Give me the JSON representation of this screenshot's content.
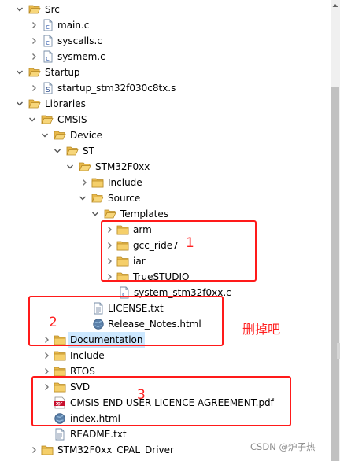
{
  "tree": {
    "rows": [
      {
        "label": "Src",
        "kind": "folder",
        "expanded": true,
        "level": 0
      },
      {
        "label": "main.c",
        "kind": "c-file",
        "expanded": false,
        "level": 1
      },
      {
        "label": "syscalls.c",
        "kind": "c-file",
        "expanded": false,
        "level": 1
      },
      {
        "label": "sysmem.c",
        "kind": "c-file",
        "expanded": false,
        "level": 1
      },
      {
        "label": "Startup",
        "kind": "folder",
        "expanded": true,
        "level": 0
      },
      {
        "label": "startup_stm32f030c8tx.s",
        "kind": "asm-file",
        "expanded": false,
        "level": 1
      },
      {
        "label": "Libraries",
        "kind": "folder",
        "expanded": true,
        "level": 0
      },
      {
        "label": "CMSIS",
        "kind": "folder",
        "expanded": true,
        "level": 1
      },
      {
        "label": "Device",
        "kind": "folder",
        "expanded": true,
        "level": 2
      },
      {
        "label": "ST",
        "kind": "folder",
        "expanded": true,
        "level": 3
      },
      {
        "label": "STM32F0xx",
        "kind": "folder",
        "expanded": true,
        "level": 4
      },
      {
        "label": "Include",
        "kind": "folder",
        "expanded": false,
        "level": 5
      },
      {
        "label": "Source",
        "kind": "folder",
        "expanded": true,
        "level": 5
      },
      {
        "label": "Templates",
        "kind": "folder",
        "expanded": true,
        "level": 6
      },
      {
        "label": "arm",
        "kind": "folder",
        "expanded": false,
        "level": 7
      },
      {
        "label": "gcc_ride7",
        "kind": "folder",
        "expanded": false,
        "level": 7
      },
      {
        "label": "iar",
        "kind": "folder",
        "expanded": false,
        "level": 7
      },
      {
        "label": "TrueSTUDIO",
        "kind": "folder",
        "expanded": false,
        "level": 7
      },
      {
        "label": "system_stm32f0xx.c",
        "kind": "c-file-plain",
        "expanded": false,
        "level": 7
      },
      {
        "label": "LICENSE.txt",
        "kind": "text-file",
        "expanded": false,
        "level": 2
      },
      {
        "label": "Release_Notes.html",
        "kind": "html-file",
        "expanded": false,
        "level": 2
      },
      {
        "label": "Documentation",
        "kind": "folder",
        "expanded": false,
        "level": 1,
        "selected": true
      },
      {
        "label": "Include",
        "kind": "folder",
        "expanded": false,
        "level": 1
      },
      {
        "label": "RTOS",
        "kind": "folder",
        "expanded": false,
        "level": 1
      },
      {
        "label": "SVD",
        "kind": "folder",
        "expanded": false,
        "level": 1
      },
      {
        "label": "CMSIS END USER LICENCE AGREEMENT.pdf",
        "kind": "pdf-file",
        "expanded": false,
        "level": 1
      },
      {
        "label": "index.html",
        "kind": "html-file",
        "expanded": false,
        "level": 1
      },
      {
        "label": "README.txt",
        "kind": "text-file",
        "expanded": false,
        "level": 1
      },
      {
        "label": "STM32F0xx_CPAL_Driver",
        "kind": "folder",
        "expanded": false,
        "level": 0
      }
    ]
  },
  "annotations": {
    "box1_number": "1",
    "box2_number": "2",
    "box3_number": "3",
    "delete_note": "删掉吧"
  },
  "watermark": "CSDN @炉子热",
  "colors": {
    "annotation_red": "#ff1a1a",
    "selection": "#cce8ff",
    "folder": "#e8b84a"
  }
}
